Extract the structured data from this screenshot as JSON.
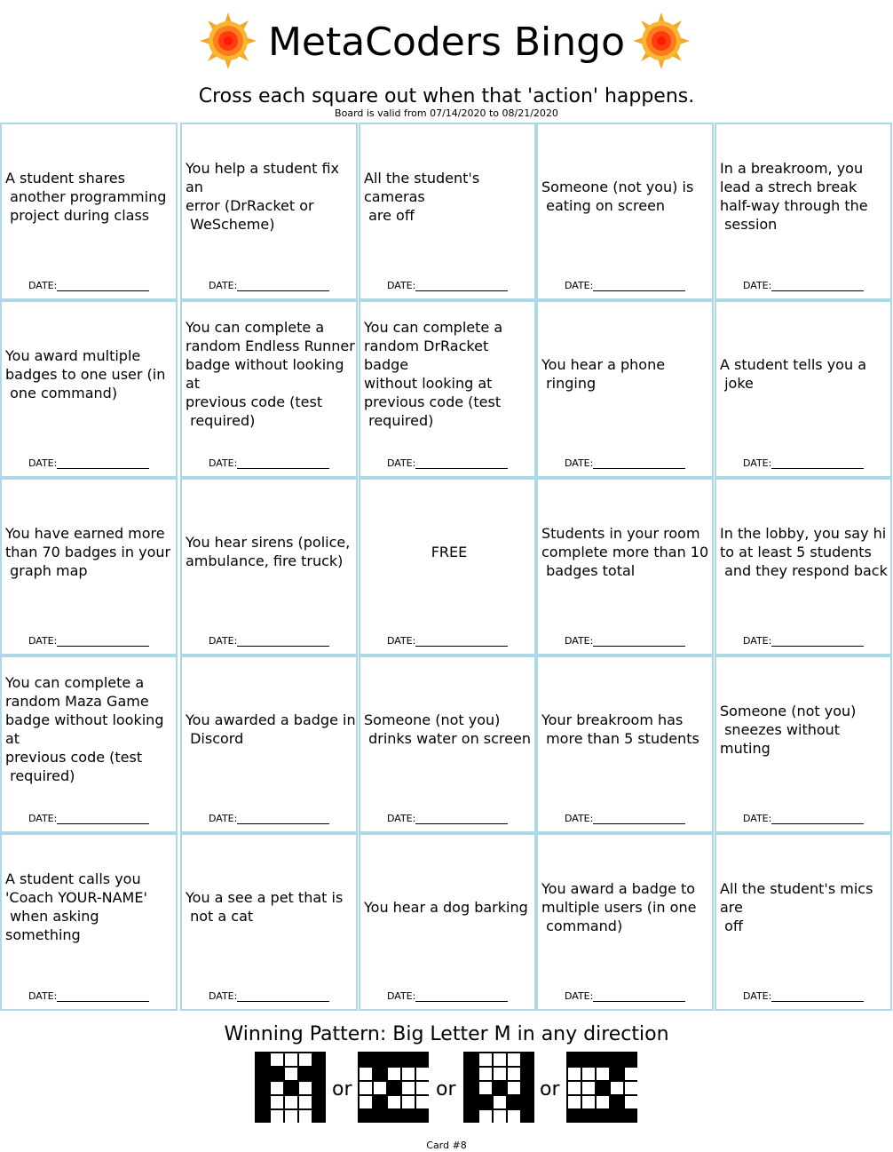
{
  "header": {
    "title": "MetaCoders Bingo",
    "subtitle": "Cross each square out when that 'action' happens.",
    "valid_text": "Board is valid from 07/14/2020 to 08/21/2020"
  },
  "date_label": "DATE:",
  "cells": [
    "A student shares\n another programming\n project during class",
    "You help a student fix an\nerror (DrRacket or\n WeScheme)",
    "All the student's cameras\n are off",
    "Someone (not you) is\n eating on screen",
    "In a breakroom, you\nlead a strech break\nhalf-way through the\n session",
    "You award multiple\nbadges to one user (in\n one command)",
    "You can complete a\nrandom Endless Runner\nbadge without looking at\nprevious code (test\n required)",
    "You can complete a\nrandom DrRacket badge\nwithout looking at\nprevious code (test\n required)",
    "You hear a phone\n ringing",
    "A student tells you a\n joke",
    "You have earned more\nthan 70 badges in your\n graph map",
    "You hear sirens (police,\nambulance, fire truck)",
    "FREE",
    "Students in your room\ncomplete more than 10\n badges total",
    "In the lobby, you say hi\nto at least 5 students\n and they respond back",
    "You can complete a\nrandom Maza Game\nbadge without looking at\nprevious code (test\n required)",
    "You awarded a badge in\n Discord",
    "Someone (not you)\n drinks water on screen",
    "Your breakroom has\n more than 5 students",
    "Someone (not you)\n sneezes without muting",
    "A student calls you\n'Coach YOUR-NAME'\n when asking something",
    "You a see a pet that is\n not a cat",
    "You hear a dog barking",
    "You award a badge to\nmultiple users (in one\n command)",
    "All the student's mics are\n off"
  ],
  "pattern_title": "Winning Pattern: Big Letter M in any direction",
  "or_label": "or",
  "card_label": "Card #8",
  "colors": {
    "cell_border": "#add8e6",
    "sun_outer": "#f0a020",
    "sun_inner": "#ff2a00"
  },
  "icons": [
    "sun-icon",
    "pattern-grid-icon"
  ]
}
